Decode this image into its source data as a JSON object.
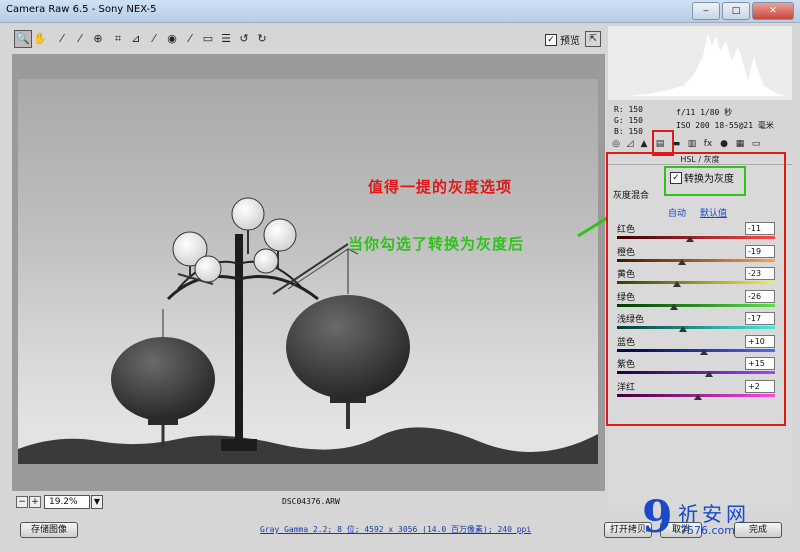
{
  "window": {
    "title": "Camera Raw 6.5 -  Sony NEX-5"
  },
  "toolbar": {
    "tools": [
      "zoom-icon",
      "hand-icon",
      "white-balance-icon",
      "color-sampler-icon",
      "target-adjust-icon",
      "crop-icon",
      "straighten-icon",
      "spot-removal-icon",
      "red-eye-icon",
      "adjustment-brush-icon",
      "graduated-filter-icon",
      "preferences-icon",
      "rotate-ccw-icon",
      "rotate-cw-icon"
    ],
    "preview_label": "预览",
    "preview_checked": true
  },
  "annotations": {
    "red_text": "值得一提的灰度选项",
    "green_text": "当你勾选了转换为灰度后"
  },
  "bottom": {
    "zoom_value": "19.2%",
    "filename": "DSC04376.ARW"
  },
  "info": {
    "rgb": [
      "R: 150",
      "G: 150",
      "B: 150"
    ],
    "exif_line1": "f/11  1/80 秒",
    "exif_line2": "ISO 200  18-55@21 毫米"
  },
  "panel": {
    "header": "HSL / 灰度",
    "convert_label": "转换为灰度",
    "convert_checked": true,
    "mix_label": "灰度混合",
    "auto_link": "自动",
    "default_link": "默认值",
    "sliders": [
      {
        "label": "红色",
        "value": "-11",
        "pos": 0.46,
        "colors": [
          "#3a0000",
          "#ff4a4a"
        ]
      },
      {
        "label": "橙色",
        "value": "-19",
        "pos": 0.41,
        "colors": [
          "#3a1a00",
          "#ffa24a"
        ]
      },
      {
        "label": "黄色",
        "value": "-23",
        "pos": 0.38,
        "colors": [
          "#3a3a00",
          "#f4f24a"
        ]
      },
      {
        "label": "绿色",
        "value": "-26",
        "pos": 0.36,
        "colors": [
          "#003a00",
          "#5ae04a"
        ]
      },
      {
        "label": "浅绿色",
        "value": "-17",
        "pos": 0.42,
        "colors": [
          "#003a3a",
          "#4ae8e0"
        ]
      },
      {
        "label": "蓝色",
        "value": "+10",
        "pos": 0.55,
        "colors": [
          "#00003a",
          "#4a6aff"
        ]
      },
      {
        "label": "紫色",
        "value": "+15",
        "pos": 0.58,
        "colors": [
          "#1a003a",
          "#9a4aff"
        ]
      },
      {
        "label": "洋红",
        "value": "+2",
        "pos": 0.51,
        "colors": [
          "#3a003a",
          "#ff4ae0"
        ]
      }
    ]
  },
  "footer": {
    "save_label": "存储图像",
    "workflow_link": "Gray Gamma 2.2; 8 位; 4592 x 3056 (14.0 百万像素); 240 ppi",
    "open_label": "打开拷贝",
    "cancel_label": "取消",
    "done_label": "完成"
  },
  "watermark": {
    "number": "9",
    "text": "祈安网",
    "url": "7576.com"
  }
}
